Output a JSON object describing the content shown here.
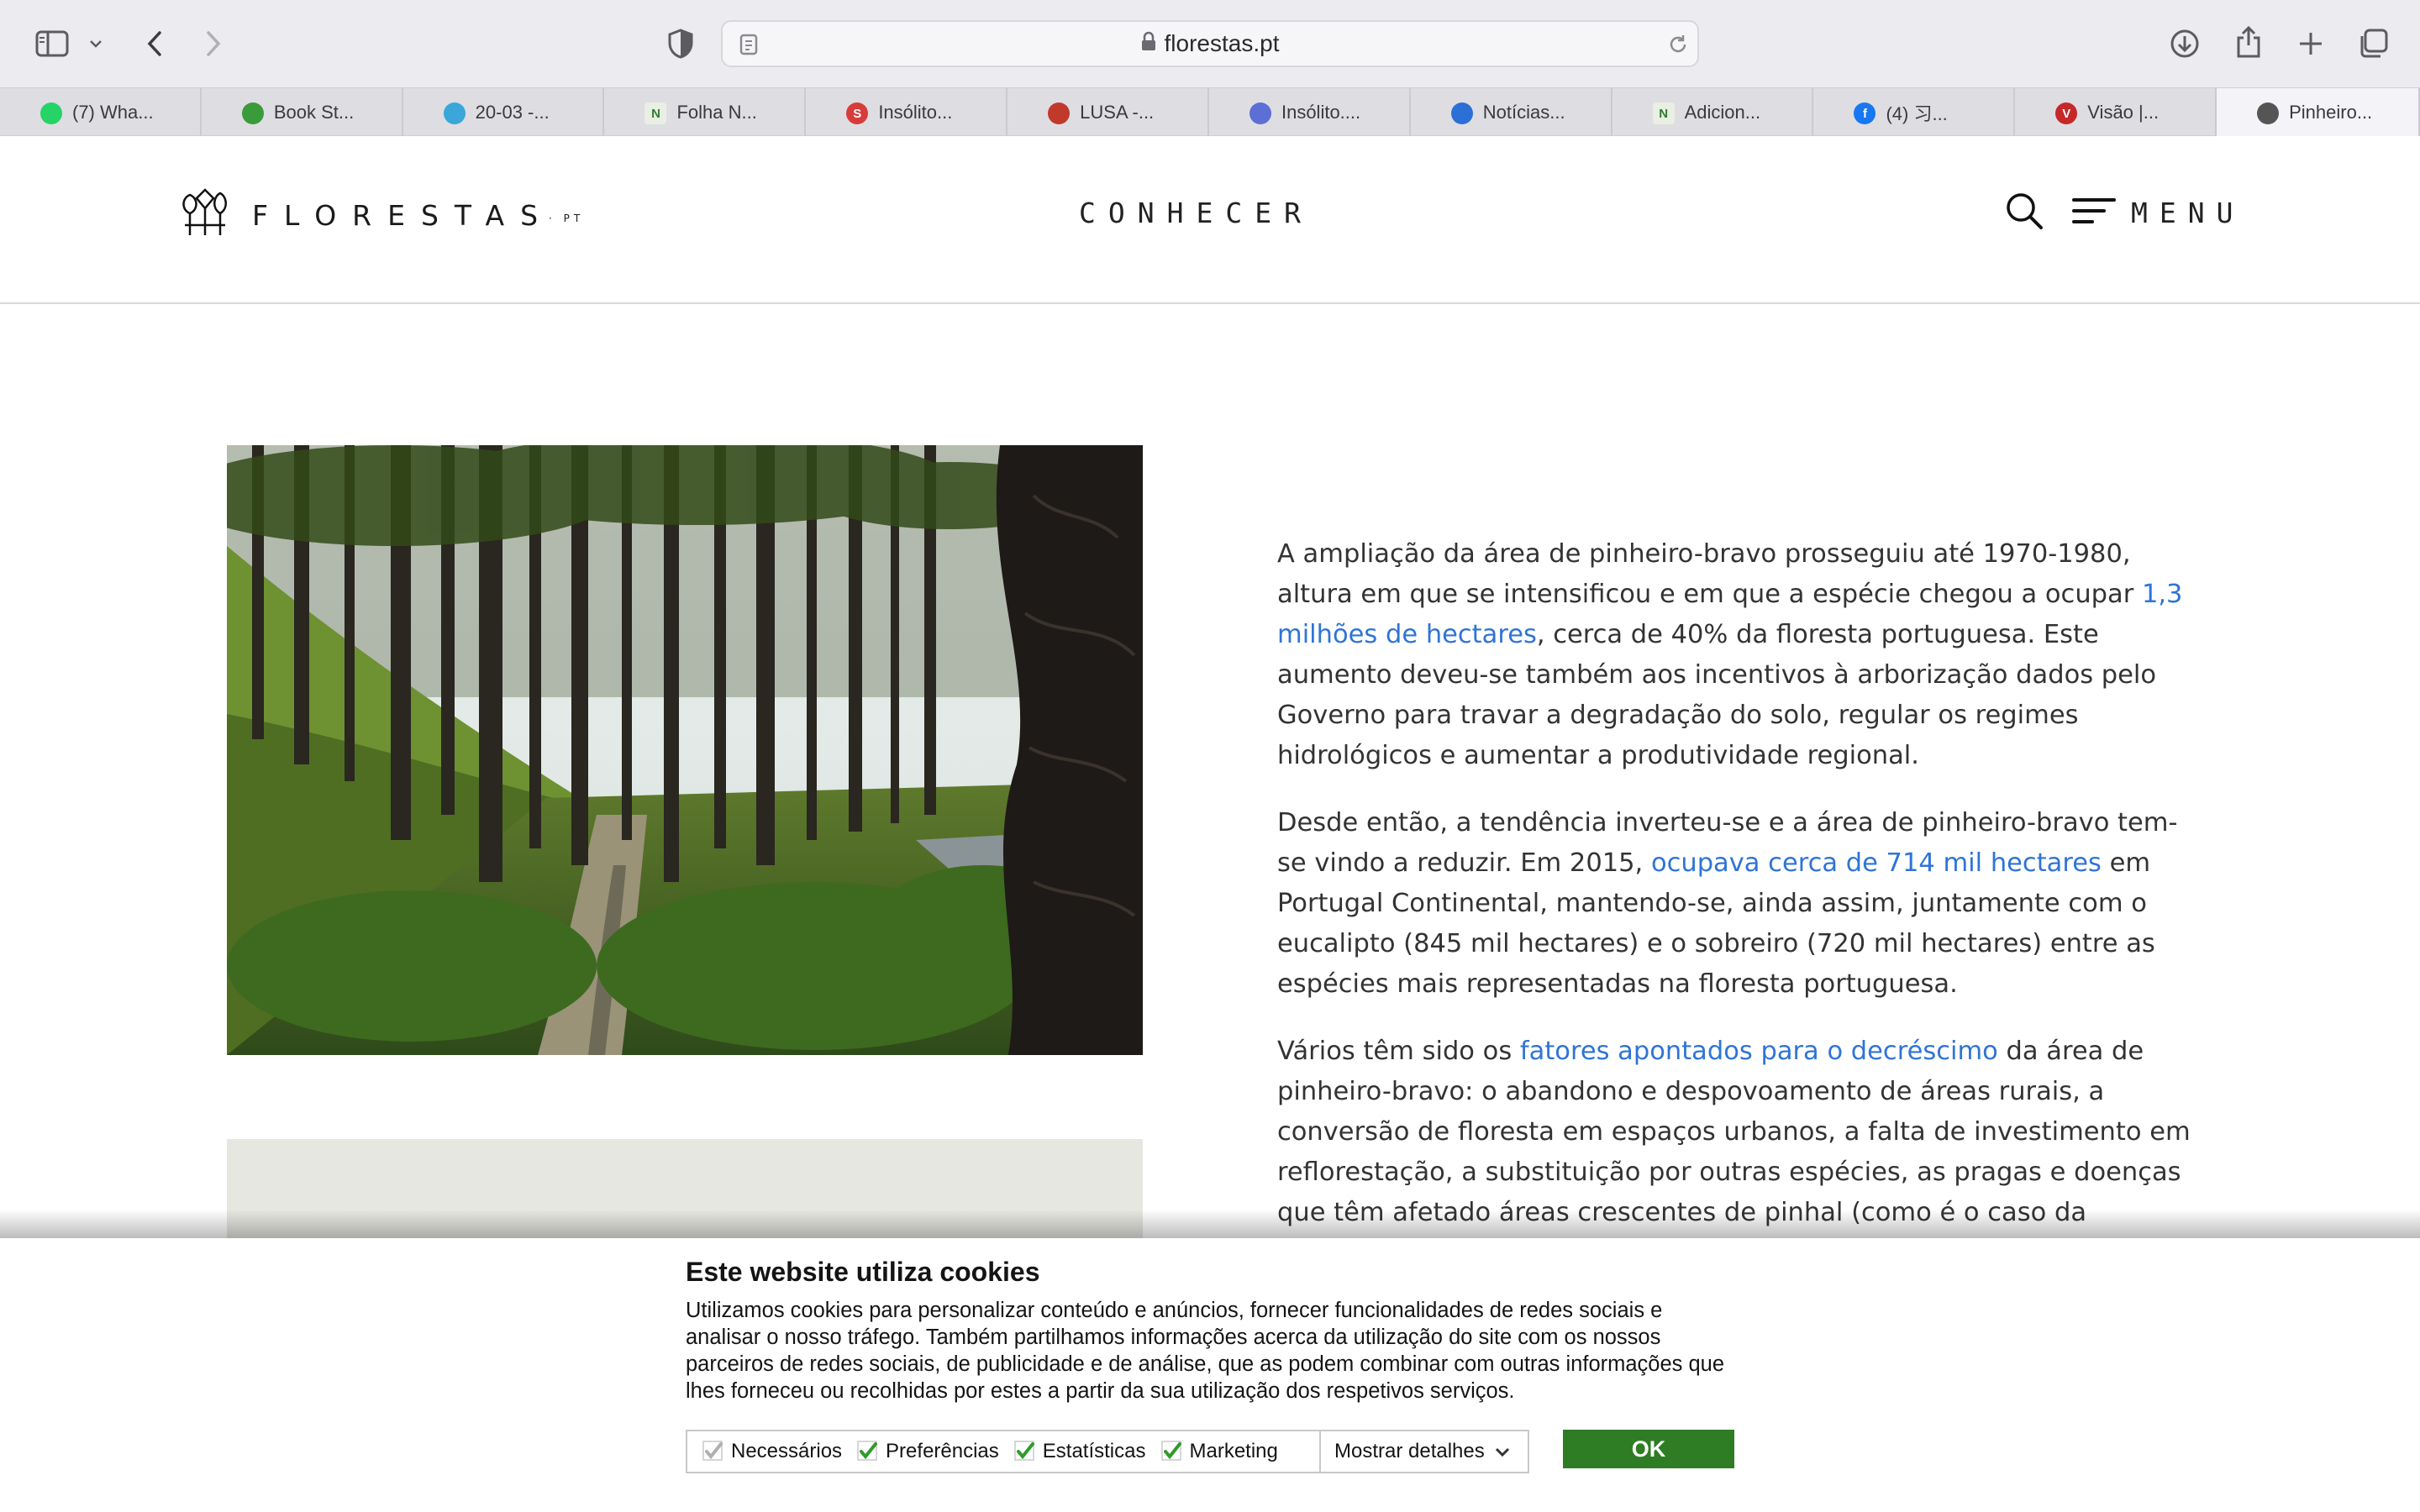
{
  "browser": {
    "address": "florestas.pt",
    "tabs": [
      {
        "label": "(7) Wha...",
        "icon": "whatsapp-icon",
        "color": "#25d366",
        "glyph": ""
      },
      {
        "label": "Book St...",
        "icon": "leaf-icon",
        "color": "#3a9b3a",
        "glyph": ""
      },
      {
        "label": "20-03 -...",
        "icon": "wave-icon",
        "color": "#3aa6d9",
        "glyph": ""
      },
      {
        "label": "Folha N...",
        "icon": "n-icon",
        "color": "#e9efe2",
        "glyph": "N"
      },
      {
        "label": "Insólito...",
        "icon": "s-icon",
        "color": "#d93a3a",
        "glyph": "S"
      },
      {
        "label": "LUSA -...",
        "icon": "lusa-icon",
        "color": "#c0392b",
        "glyph": ""
      },
      {
        "label": "Insólito....",
        "icon": "mountain-icon",
        "color": "#5b6fd6",
        "glyph": ""
      },
      {
        "label": "Notícias...",
        "icon": "clock-icon",
        "color": "#2c6fd6",
        "glyph": ""
      },
      {
        "label": "Adicion...",
        "icon": "n-icon",
        "color": "#e9efe2",
        "glyph": "N"
      },
      {
        "label": "(4) 习...",
        "icon": "facebook-icon",
        "color": "#1877f2",
        "glyph": "f"
      },
      {
        "label": "Visão |...",
        "icon": "v-icon",
        "color": "#c62828",
        "glyph": "V"
      },
      {
        "label": "Pinheiro...",
        "icon": "florestas-icon",
        "color": "#555555",
        "glyph": ""
      }
    ]
  },
  "site": {
    "logo_text": "FLORESTAS",
    "logo_suffix": "· PT",
    "nav_center": "CONHECER",
    "menu_label": "MENU"
  },
  "article": {
    "p1_a": "A ampliação da área de pinheiro-bravo prosseguiu até 1970-1980, altura em que se intensificou e em que a espécie chegou a ocupar ",
    "p1_link": "1,3 milhões de hectares",
    "p1_b": ", cerca de 40% da floresta portuguesa. Este aumento deveu-se também aos incentivos à arborização dados pelo Governo para travar a degradação do solo, regular os regimes hidrológicos e aumentar a produtividade regional.",
    "p2_a": "Desde então, a tendência inverteu-se e a área de pinheiro-bravo tem-se vindo a reduzir. Em 2015, ",
    "p2_link": "ocupava cerca de 714 mil hectares",
    "p2_b": " em Portugal Continental, mantendo-se, ainda assim, juntamente com o eucalipto (845 mil hectares) e o sobreiro (720 mil hectares) entre as espécies mais representadas na floresta portuguesa.",
    "p3_a": "Vários têm sido os ",
    "p3_link": "fatores apontados para o decréscimo",
    "p3_b": " da área de pinheiro-bravo: o abandono e despovoamento de áreas rurais, a conversão de floresta em espaços urbanos, a falta de investimento em reflorestação, a substituição por outras espécies, as pragas e doenças que têm afetado áreas crescentes de pinhal (como é o caso da murchidão do pinheiro) e a vaga de incêndios que"
  },
  "cookies": {
    "title": "Este website utiliza cookies",
    "text": "Utilizamos cookies para personalizar conteúdo e anúncios, fornecer funcionalidades de redes sociais e analisar o nosso tráfego. Também partilhamos informações acerca da utilização do site com os nossos parceiros de redes sociais, de publicidade e de análise, que as podem combinar com outras informações que lhes forneceu ou recolhidas por estes a partir da sua utilização dos respetivos serviços.",
    "options": [
      {
        "label": "Necessários",
        "checked": true,
        "disabled": true
      },
      {
        "label": "Preferências",
        "checked": true,
        "disabled": false
      },
      {
        "label": "Estatísticas",
        "checked": true,
        "disabled": false
      },
      {
        "label": "Marketing",
        "checked": true,
        "disabled": false
      }
    ],
    "details_label": "Mostrar detalhes",
    "ok_label": "OK",
    "ok_color": "#2e7d24"
  }
}
